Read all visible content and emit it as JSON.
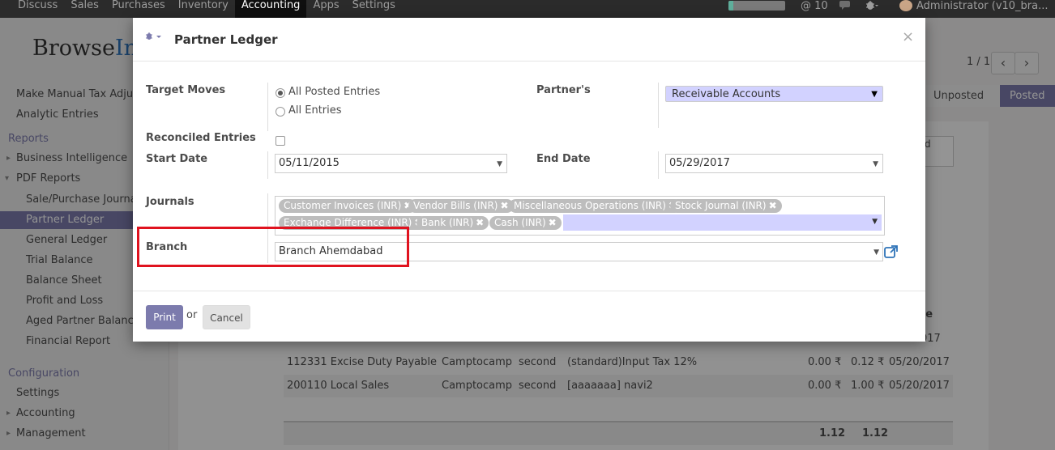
{
  "topbar": {
    "menu": [
      "Discuss",
      "Sales",
      "Purchases",
      "Inventory",
      "Accounting",
      "Apps",
      "Settings"
    ],
    "active": "Accounting",
    "progress": 0.08,
    "at_count": "@ 10",
    "user": "Administrator (v10_bra..."
  },
  "sidebar": {
    "logo_a": "Browse",
    "logo_b": "Inf",
    "top_items": [
      "Make Manual Tax Adjus...",
      "Analytic Entries"
    ],
    "reports_head": "Reports",
    "business_intelligence": "Business Intelligence",
    "pdf_reports": "PDF Reports",
    "pdf_items": [
      "Sale/Purchase Journal",
      "Partner Ledger",
      "General Ledger",
      "Trial Balance",
      "Balance Sheet",
      "Profit and Loss",
      "Aged Partner Balance",
      "Financial Report"
    ],
    "config_head": "Configuration",
    "settings": "Settings",
    "accounting": "Accounting",
    "management": "Management"
  },
  "background": {
    "pager": "1 / 1",
    "status_unposted": "Unposted",
    "status_posted": "Posted",
    "partial_text": "d",
    "col_date_header": "te",
    "row1": {
      "account": "",
      "partner": "",
      "label": "",
      "ref": "",
      "debit": "",
      "credit": "",
      "date": "017"
    },
    "row2": {
      "account": "112331 Excise Duty Payable",
      "partner": "Camptocamp",
      "label": "second",
      "ref": "(standard)Input Tax 12%",
      "debit": "0.00 ₹",
      "credit": "0.12 ₹",
      "date": "05/20/2017"
    },
    "row3": {
      "account": "200110 Local Sales",
      "partner": "Camptocamp",
      "label": "second",
      "ref": "[aaaaaaa] navi2",
      "debit": "0.00 ₹",
      "credit": "1.00 ₹",
      "date": "05/20/2017"
    },
    "sum_debit": "1.12",
    "sum_credit": "1.12"
  },
  "modal": {
    "title": "Partner Ledger",
    "close": "×",
    "target_moves_label": "Target Moves",
    "radio_all_posted": "All Posted Entries",
    "radio_all_entries": "All Entries",
    "partners_label": "Partner's",
    "partners_value": "Receivable Accounts",
    "reconciled_label": "Reconciled Entries",
    "start_date_label": "Start Date",
    "start_date_value": "05/11/2015",
    "end_date_label": "End Date",
    "end_date_value": "05/29/2017",
    "journals_label": "Journals",
    "journal_tags": [
      "Customer Invoices (INR)",
      "Vendor Bills (INR)",
      "Miscellaneous Operations (INR)",
      "Stock Journal (INR)",
      "Exchange Difference (INR)",
      "Bank (INR)",
      "Cash (INR)"
    ],
    "branch_label": "Branch",
    "branch_value": "Branch Ahemdabad",
    "print_label": "Print",
    "or_label": "or",
    "cancel_label": "Cancel"
  },
  "colors": {
    "accent": "#7c7bad",
    "highlight": "#e0131f",
    "select_bg": "#d2d2ff"
  }
}
